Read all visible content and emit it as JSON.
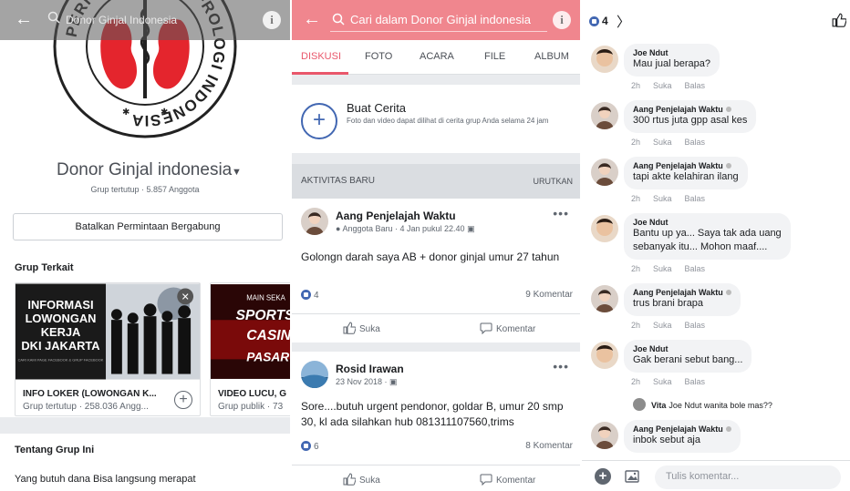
{
  "panel1": {
    "search_text": "Donor Ginjal Indonesia",
    "logo_text": "PERHIMPUNAN NEFROLOGI INDONESIA",
    "group_name": "Donor Ginjal indonesia",
    "group_meta": "Grup tertutup · 5.857 Anggota",
    "cancel_label": "Batalkan Permintaan Bergabung",
    "related_title": "Grup Terkait",
    "cards": [
      {
        "image_lines": [
          "INFORMASI",
          "LOWONGAN",
          "KERJA",
          "DKI JAKARTA"
        ],
        "image_footnote": "CARI KAMI PAGE FACEBOOK & GRUP FACEBOOK",
        "title": "INFO LOKER (LOWONGAN K...",
        "meta": "Grup tertutup · 258.036 Angg..."
      },
      {
        "image_lines": [
          "MAIN SEKA",
          "SPORTS",
          "CASIN",
          "PASAR"
        ],
        "title": "VIDEO LUCU, G",
        "meta": "Grup publik · 73"
      }
    ],
    "about_title": "Tentang Grup Ini",
    "about_text": "Yang butuh dana Bisa langsung merapat"
  },
  "panel2": {
    "search_placeholder": "Cari dalam Donor Ginjal indonesia",
    "tabs": [
      "DISKUSI",
      "FOTO",
      "ACARA",
      "FILE",
      "ALBUM"
    ],
    "story_title": "Buat Cerita",
    "story_sub": "Foto dan video dapat dilihat di cerita grup Anda selama 24 jam",
    "activity_label": "AKTIVITAS BARU",
    "sort_label": "URUTKAN",
    "posts": [
      {
        "author": "Aang Penjelajah Waktu",
        "meta": "Anggota Baru · 4 Jan pukul 22.40",
        "text": "Golongn darah saya AB + donor ginjal umur 27 tahun",
        "likes": "4",
        "comments": "9 Komentar"
      },
      {
        "author": "Rosid Irawan",
        "meta": "23 Nov 2018",
        "text": "Sore....butuh urgent pendonor, goldar B, umur 20 smp 30, kl ada silahkan hub 081311107560,trims",
        "likes": "6",
        "comments": "8 Komentar"
      }
    ],
    "like_label": "Suka",
    "comment_label": "Komentar"
  },
  "panel3": {
    "reaction_count": "4",
    "comments": [
      {
        "name": "Joe Ndut",
        "text": [
          "Mau jual berapa?"
        ],
        "time": "2h"
      },
      {
        "name": "Aang Penjelajah Waktu",
        "text": [
          "300 rtus juta gpp asal kes"
        ],
        "time": "2h"
      },
      {
        "name": "Aang Penjelajah Waktu",
        "text": [
          "tapi akte kelahiran ilang"
        ],
        "time": "2h"
      },
      {
        "name": "Joe Ndut",
        "text": [
          "Bantu up ya... Saya tak ada uang",
          "sebanyak itu... Mohon maaf...."
        ],
        "time": "2h"
      },
      {
        "name": "Aang Penjelajah Waktu",
        "text": [
          "trus brani brapa"
        ],
        "time": "2h"
      },
      {
        "name": "Joe Ndut",
        "text": [
          "Gak berani sebut bang..."
        ],
        "time": "2h"
      },
      {
        "name": "Aang Penjelajah Waktu",
        "text": [
          "inbok sebut aja"
        ],
        "time": ""
      }
    ],
    "like_action": "Suka",
    "reply_action": "Balas",
    "reply_preview": {
      "name": "Vita",
      "text": "Joe Ndut wanita bole mas??"
    },
    "composer_placeholder": "Tulis komentar..."
  },
  "colors": {
    "accent_pink": "#e9576b",
    "search_bar_pink": "#f0868e",
    "facebook_blue": "#4267b2",
    "logo_red": "#e4252d"
  }
}
